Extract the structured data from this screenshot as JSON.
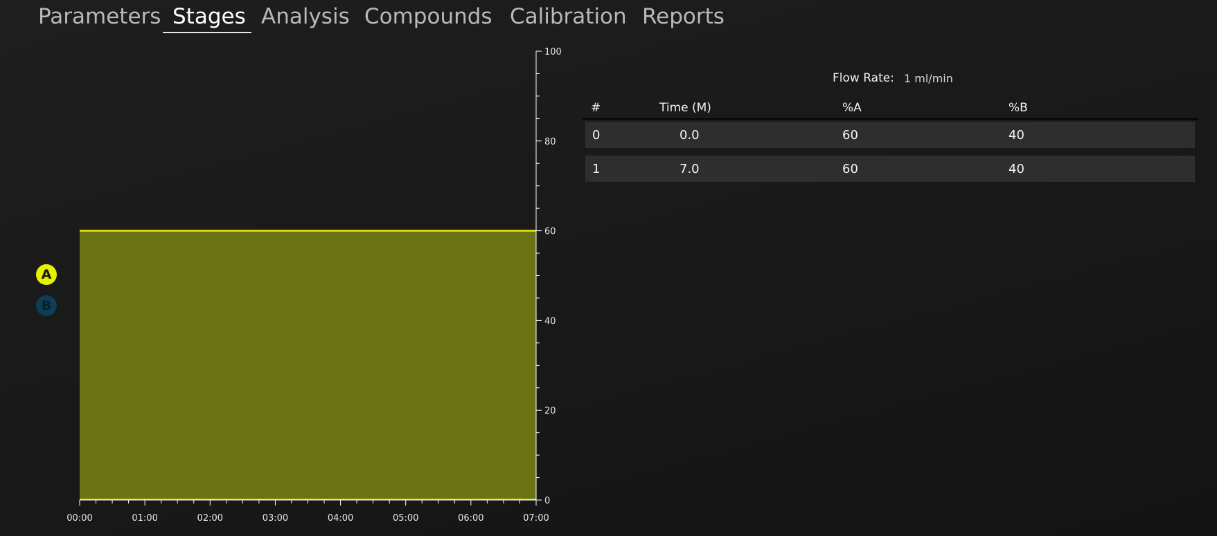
{
  "tabs": [
    {
      "label": "Parameters"
    },
    {
      "label": "Stages"
    },
    {
      "label": "Analysis"
    },
    {
      "label": "Compounds"
    },
    {
      "label": "Calibration"
    },
    {
      "label": "Reports"
    }
  ],
  "active_tab": "Stages",
  "series_toggles": [
    {
      "label": "A",
      "color": "#e6f200",
      "active": true
    },
    {
      "label": "B",
      "color": "#0c3e55",
      "active": false
    }
  ],
  "flow_rate": {
    "label": "Flow Rate:",
    "value": "1 ml/min"
  },
  "table": {
    "columns": [
      "#",
      "Time (M)",
      "%A",
      "%B"
    ],
    "rows": [
      {
        "index": "0",
        "time": "0.0",
        "a": "60",
        "b": "40"
      },
      {
        "index": "1",
        "time": "7.0",
        "a": "60",
        "b": "40"
      }
    ]
  },
  "chart_data": {
    "type": "area",
    "x": [
      0,
      7
    ],
    "series": [
      {
        "name": "A",
        "values": [
          60,
          60
        ],
        "color": "#e6f200",
        "fill": "#6b7415"
      }
    ],
    "x_tick_labels": [
      "00:00",
      "01:00",
      "02:00",
      "03:00",
      "04:00",
      "05:00",
      "06:00",
      "07:00"
    ],
    "y_tick_labels": [
      "0",
      "20",
      "40",
      "60",
      "80",
      "100"
    ],
    "xlim": [
      0,
      7
    ],
    "ylim": [
      0,
      100
    ],
    "x_unit": "minutes",
    "y_axis_side": "right",
    "grid": false
  }
}
